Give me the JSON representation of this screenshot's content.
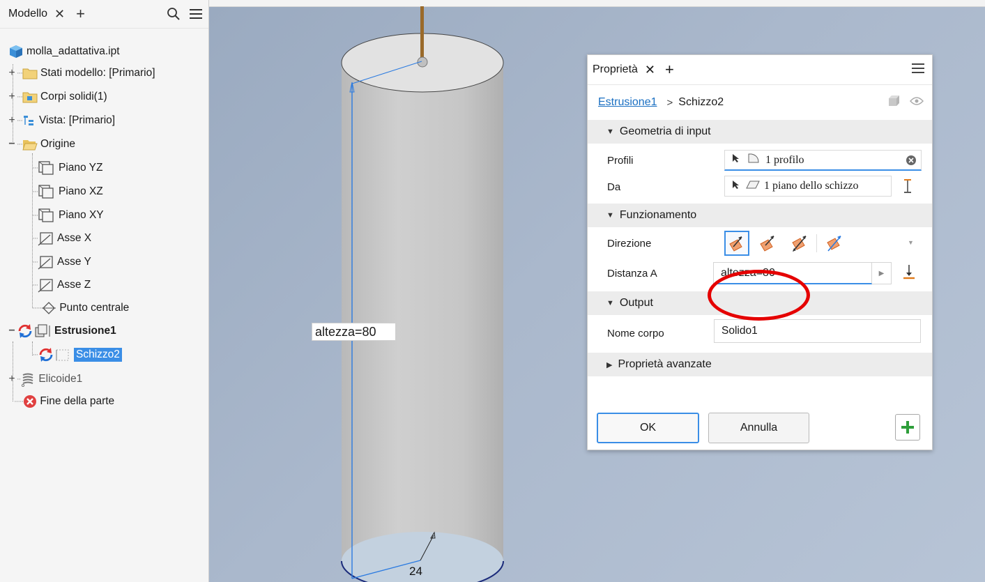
{
  "browser": {
    "title": "Modello",
    "close": "✕",
    "add": "+",
    "items": [
      {
        "label": "molla_adattativa.ipt"
      },
      {
        "label": "Stati modello: [Primario]"
      },
      {
        "label": "Corpi solidi(1)"
      },
      {
        "label": "Vista: [Primario]"
      },
      {
        "label": "Origine"
      },
      {
        "label": "Piano YZ"
      },
      {
        "label": "Piano XZ"
      },
      {
        "label": "Piano XY"
      },
      {
        "label": "Asse X"
      },
      {
        "label": "Asse Y"
      },
      {
        "label": "Asse Z"
      },
      {
        "label": "Punto centrale"
      },
      {
        "label": "Estrusione1"
      },
      {
        "label": "Schizzo2"
      },
      {
        "label": "Elicoide1"
      },
      {
        "label": "Fine della parte"
      }
    ]
  },
  "viewport": {
    "dimension_label": "altezza=80",
    "radius_label": "24"
  },
  "properties": {
    "title": "Proprietà",
    "close": "✕",
    "add": "+",
    "breadcrumb": {
      "feature": "Estrusione1",
      "separator": ">",
      "sketch": "Schizzo2"
    },
    "sections": {
      "input_geometry": "Geometria di input",
      "behavior": "Funzionamento",
      "output": "Output",
      "advanced": "Proprietà avanzate"
    },
    "fields": {
      "profiles_label": "Profili",
      "profiles_value": "1 profilo",
      "from_label": "Da",
      "from_value": "1 piano dello schizzo",
      "direction_label": "Direzione",
      "distance_label": "Distanza A",
      "distance_value": "altezza=80",
      "body_name_label": "Nome corpo",
      "body_name_value": "Solido1"
    },
    "buttons": {
      "ok": "OK",
      "cancel": "Annulla",
      "add": "+"
    }
  },
  "colors": {
    "accent": "#3a8ee6",
    "highlight_circle": "#e50000",
    "add_green": "#2e9e3a"
  }
}
